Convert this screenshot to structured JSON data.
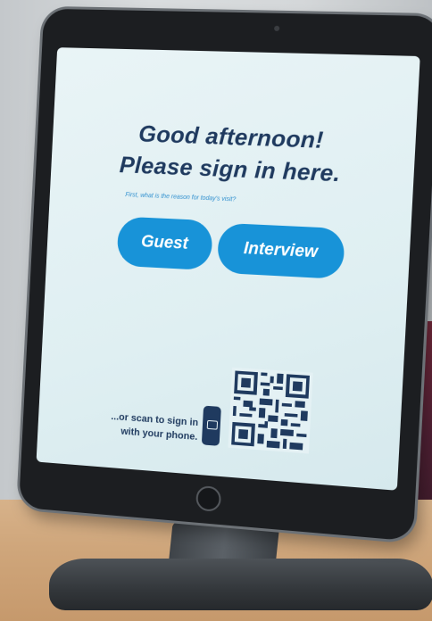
{
  "screen": {
    "greeting": "Good afternoon!",
    "instruction": "Please sign in here.",
    "reason_prompt": "First, what is the reason for today's visit?",
    "buttons": {
      "guest": "Guest",
      "interview": "Interview"
    },
    "scan": {
      "line1": "...or scan to sign in",
      "line2": "with your phone."
    }
  },
  "colors": {
    "accent": "#1893d8",
    "text_dark": "#1f3a5f",
    "screen_bg": "#e4f1f4"
  },
  "icons": [
    "phone-icon",
    "qr-code"
  ]
}
